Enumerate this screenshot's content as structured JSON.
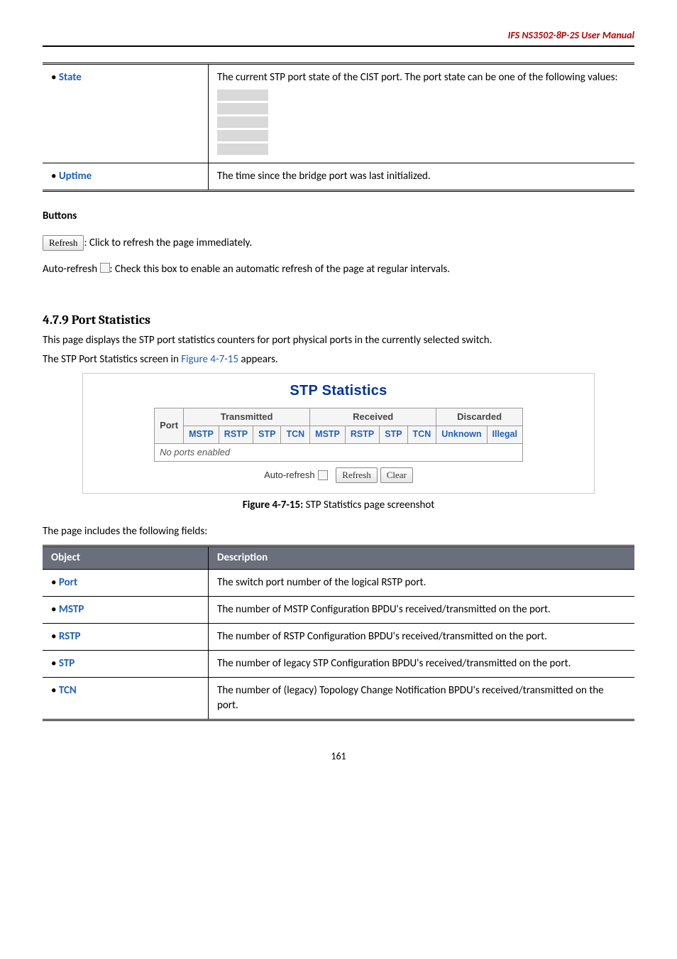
{
  "header": {
    "manual_title": "IFS  NS3502-8P-2S  User  Manual"
  },
  "state_table": {
    "rows": [
      {
        "label": "State",
        "desc": "The current STP port state of the CIST port. The port state can be one of the following values:",
        "has_blocks": true
      },
      {
        "label": "Uptime",
        "desc": "The time since the bridge port was last initialized.",
        "has_blocks": false
      }
    ]
  },
  "buttons_section": {
    "heading": "Buttons",
    "refresh_btn": "Refresh",
    "refresh_desc": ": Click to refresh the page immediately.",
    "auto_refresh_label": "Auto-refresh  ",
    "auto_refresh_desc": ": Check this box to enable an automatic refresh of the page at regular intervals."
  },
  "section_479": {
    "heading": "4.7.9 Port Statistics",
    "intro": "This page displays the STP port statistics counters for port physical ports in the currently selected switch.",
    "caption_prefix": "The STP Port Statistics screen in ",
    "caption_ref": "Figure 4-7-15",
    "caption_suffix": " appears."
  },
  "stats_panel": {
    "title": "STP Statistics",
    "port_header": "Port",
    "groups": [
      "Transmitted",
      "Received",
      "Discarded"
    ],
    "sub_headers": {
      "transmitted": [
        "MSTP",
        "RSTP",
        "STP",
        "TCN"
      ],
      "received": [
        "MSTP",
        "RSTP",
        "STP",
        "TCN"
      ],
      "discarded": [
        "Unknown",
        "Illegal"
      ]
    },
    "no_ports": "No ports enabled",
    "controls": {
      "auto_refresh": "Auto-refresh",
      "refresh_btn": "Refresh",
      "clear_btn": "Clear"
    }
  },
  "figure_caption": {
    "bold": "Figure 4-7-15:",
    "rest": " STP Statistics page screenshot"
  },
  "fields_intro": "The page includes the following fields:",
  "obj_table": {
    "head_object": "Object",
    "head_description": "Description",
    "rows": [
      {
        "label": "Port",
        "desc": "The switch port number of the logical RSTP port."
      },
      {
        "label": "MSTP",
        "desc": "The number of MSTP Configuration BPDU's received/transmitted on the port."
      },
      {
        "label": "RSTP",
        "desc": "The number of RSTP Configuration BPDU's received/transmitted on the port."
      },
      {
        "label": "STP",
        "desc": "The number of legacy STP Configuration BPDU's received/transmitted on the port."
      },
      {
        "label": "TCN",
        "desc": "The number of (legacy) Topology Change Notification BPDU's received/transmitted on the port."
      }
    ]
  },
  "page_number": "161",
  "chart_data": {
    "type": "table",
    "title": "STP Statistics",
    "columns": [
      "Port",
      "MSTP (Tx)",
      "RSTP (Tx)",
      "STP (Tx)",
      "TCN (Tx)",
      "MSTP (Rx)",
      "RSTP (Rx)",
      "STP (Rx)",
      "TCN (Rx)",
      "Unknown (Discarded)",
      "Illegal (Discarded)"
    ],
    "rows": [],
    "note": "No ports enabled"
  }
}
